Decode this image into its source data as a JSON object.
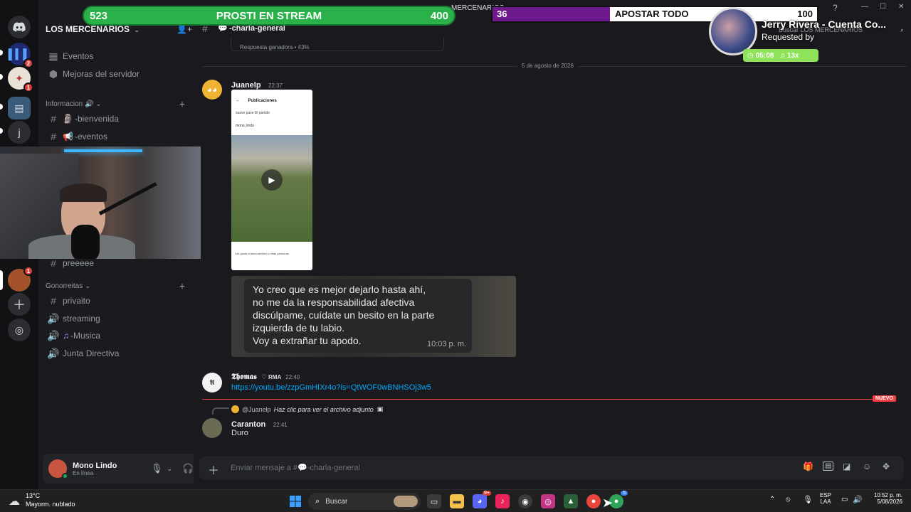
{
  "window": {
    "server_title": "MERCENARIOS",
    "controls": {
      "minimize": "—",
      "maximize": "☐",
      "close": "✕"
    }
  },
  "rail": {
    "badges": [
      "2",
      "1",
      "1"
    ],
    "letter_icon": "j"
  },
  "server": {
    "name": "LOS MERCENARIOS",
    "events_label": "Eventos",
    "boost_label": "Mejoras del servidor",
    "categories": {
      "info": "Informacion",
      "gonorreitas": "Gonorreitas"
    },
    "channels": {
      "bienvenida": "-bienvenida",
      "eventos": "-eventos",
      "preeeee": "preeeee",
      "privaito": "privaito",
      "streaming": "streaming",
      "musica": "-Musica",
      "junta": "Junta Directiva"
    }
  },
  "user_panel": {
    "name": "Mono Lindo",
    "status": "En línea"
  },
  "channel_header": {
    "name": "-charla-general",
    "search_placeholder": "Buscar LOS MERCENARIOS"
  },
  "poll_result": {
    "text": "Respuesta ganadora • 43%"
  },
  "date_divider": "5 de agosto de 2026",
  "messages": [
    {
      "author": "Juanelp",
      "time": "22:37",
      "phone_screenshot": {
        "header": "Publicaciones",
        "caption": "suave pase El partido",
        "username": "mono_lindo",
        "likes_text": "Les gusta a laura.ramirez y otras personas"
      },
      "chat_image": {
        "lines": [
          "Yo creo que es mejor dejarlo hasta ahí,",
          "no me da la responsabilidad afectiva",
          "discúlpame, cuídate un besito en la parte",
          "izquierda de tu labio.",
          "Voy a extrañar tu apodo."
        ],
        "time": "10:03 p. m."
      }
    },
    {
      "author": "𝕿𝖍𝖔𝖒𝖆𝖘",
      "badge": "RMA",
      "time": "22:40",
      "link": "https://youtu.be/zzpGmHIXr4o?is=QtWOF0wBNHSOj3w5"
    },
    {
      "new_label": "NUEVO",
      "reply_to": "@Juanelp",
      "reply_text": "Haz clic para ver el archivo adjunto",
      "author": "Caranton",
      "time": "22:41",
      "text": "Duro"
    }
  ],
  "composer": {
    "placeholder": "Enviar mensaje a #💬-charla-general"
  },
  "overlays": {
    "prediction": {
      "left": "523",
      "title": "PROSTI EN STREAM",
      "right": "400"
    },
    "bet": {
      "left": "36",
      "title": "APOSTAR TODO",
      "right": "100"
    },
    "music": {
      "title": "Jerry Rivera - Cuenta Co...",
      "requested": "Requested by",
      "timer": "05:08",
      "count": "13x"
    }
  },
  "taskbar": {
    "weather_temp": "13°C",
    "weather_desc": "Mayorm. nublado",
    "search": "Buscar",
    "lang": "ESP",
    "region": "LAA",
    "clock": "10:52 p. m.",
    "date": "5/08/2026",
    "badges": {
      "discord": "9+",
      "chrome": "5"
    }
  },
  "colors": {
    "bg": "#1a1a1e",
    "sidebar": "#1b1b1f",
    "rail": "#121214",
    "link": "#00a8fc",
    "new_red": "#f23f43",
    "prediction_green": "#2bb14a",
    "bet_purple": "#6f1a8c",
    "music_green": "#8ee35b"
  },
  "icons": {
    "discord": "discord-logo-icon",
    "hash": "hash-icon",
    "speaker": "speaker-icon",
    "plus": "plus-icon",
    "mic": "mic-icon",
    "headset": "headset-icon",
    "gear": "gear-icon"
  }
}
